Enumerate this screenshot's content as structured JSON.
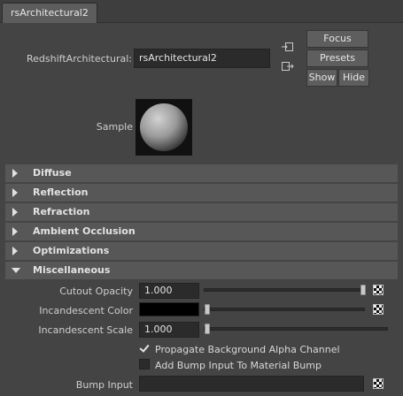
{
  "tab": {
    "label": "rsArchitectural2"
  },
  "node": {
    "type_label": "RedshiftArchitectural:",
    "name_value": "rsArchitectural2"
  },
  "buttons": {
    "focus": "Focus",
    "presets": "Presets",
    "show": "Show",
    "hide": "Hide"
  },
  "sample": {
    "label": "Sample"
  },
  "sections": [
    {
      "label": "Diffuse",
      "expanded": false
    },
    {
      "label": "Reflection",
      "expanded": false
    },
    {
      "label": "Refraction",
      "expanded": false
    },
    {
      "label": "Ambient Occlusion",
      "expanded": false
    },
    {
      "label": "Optimizations",
      "expanded": false
    },
    {
      "label": "Miscellaneous",
      "expanded": true
    }
  ],
  "misc": {
    "cutout_opacity": {
      "label": "Cutout Opacity",
      "value": "1.000",
      "slider_fraction": 1.0
    },
    "incandescent_color": {
      "label": "Incandescent Color",
      "swatch_color": "#000000",
      "slider_fraction": 0.0
    },
    "incandescent_scale": {
      "label": "Incandescent Scale",
      "value": "1.000",
      "slider_fraction": 0.0
    },
    "propagate_alpha": {
      "label": "Propagate Background Alpha Channel",
      "checked": true
    },
    "add_bump": {
      "label": "Add Bump Input To Material Bump",
      "checked": false
    },
    "bump_input": {
      "label": "Bump Input",
      "value": ""
    }
  },
  "colors": {
    "background": "#444444",
    "section_header": "#575757",
    "field": "#2b2b2b",
    "button": "#5e5e5e"
  }
}
